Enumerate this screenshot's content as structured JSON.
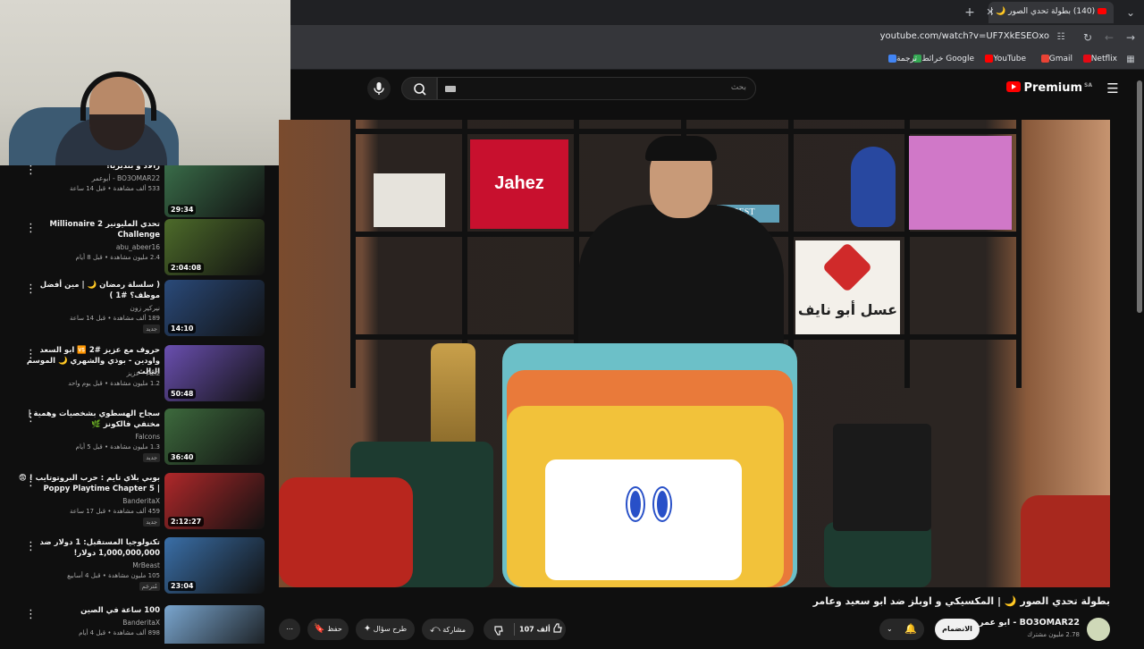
{
  "browser": {
    "tab_title": "(140) بطولة تحدي الصور 🌙 | ال",
    "url": "youtube.com/watch?v=UF7XkESEOxo",
    "bookmarks": [
      "Netflix",
      "Gmail",
      "YouTube",
      "خرائط Google",
      "ترجمة"
    ]
  },
  "youtube": {
    "logo": "Premium",
    "logo_region": "SA",
    "search_placeholder": "بحث"
  },
  "recommendations": [
    {
      "title": "رالاد و بنديربا!",
      "channel": "BO3OMAR22 - أبوعمر",
      "meta": "533 ألف مشاهدة • قبل 14 ساعة",
      "duration": "29:34",
      "thumb": "#3a6e4a",
      "new": false
    },
    {
      "title": "تحدي المليونير 2 Millionaire Challenge",
      "channel": "abu_abeer16",
      "meta": "2.4 مليون مشاهدة • قبل 8 أيام",
      "duration": "2:04:08",
      "thumb": "#4d6b2a",
      "new": false
    },
    {
      "title": "( سلسلة رمضان 🌙 | مين أفضل موظف؟ #1 )",
      "channel": "نيركير زون",
      "meta": "189 ألف مشاهدة • قبل 14 ساعة",
      "duration": "14:10",
      "thumb": "#2a4a7a",
      "new": true
    },
    {
      "title": "حروف مع عزيز #2 🆚 ابو السعد واودين - بوذي والشهري 🌙 الموسم الثالث",
      "channel": "Aziz - عزيز",
      "meta": "1.2 مليون مشاهدة • قبل يوم واحد",
      "duration": "50:48",
      "thumb": "#6a4fb0",
      "new": false
    },
    {
      "title": "سجاح الهسطوي بشخصيات وهمية | مختفي فالكونز 🌿",
      "channel": "Falcons",
      "meta": "1.3 مليون مشاهدة • قبل 5 أيام",
      "duration": "36:40",
      "thumb": "#3d6a3d",
      "new": true
    },
    {
      "title": "بوبي بلاي تايم : حرب البروتوتايب ! 😨 | Poppy Playtime Chapter 5",
      "channel": "BanderitaX",
      "meta": "459 ألف مشاهدة • قبل 17 ساعة",
      "duration": "2:12:27",
      "thumb": "#b0282a",
      "new": true
    },
    {
      "title": "تكنولوجيا المستقبل: 1 دولار ضد 1,000,000,000 دولار!",
      "channel": "MrBeast",
      "meta": "105 مليون مشاهدة • قبل 4 أسابيع",
      "duration": "23:04",
      "thumb": "#3a6fa8",
      "new": false,
      "badge": "مُترجَم"
    },
    {
      "title": "100 ساعة في الصين",
      "channel": "BanderitaX",
      "meta": "898 ألف مشاهدة • قبل 4 أيام",
      "duration": "",
      "thumb": "#7aa6cf",
      "new": false
    }
  ],
  "player": {
    "brand_jahez": "Jahez",
    "brand_honey": "عسل أبو نايف",
    "shelf_book": "BEST"
  },
  "video": {
    "title": "بطولة تحدي الصور 🌙 | المكسيكي و اوبلز ضد ابو سعيد وعامر",
    "channel": "BO3OMAR22 - ابو عمر",
    "subscribers": "2.78 مليون مشترك",
    "join_label": "الانضمام",
    "likes": "107 ألف",
    "share_label": "مشاركة",
    "ask_label": "طرح سؤال",
    "save_label": "حفظ"
  },
  "colors": {
    "accent": "#ff0000",
    "background": "#0f0f0f"
  }
}
